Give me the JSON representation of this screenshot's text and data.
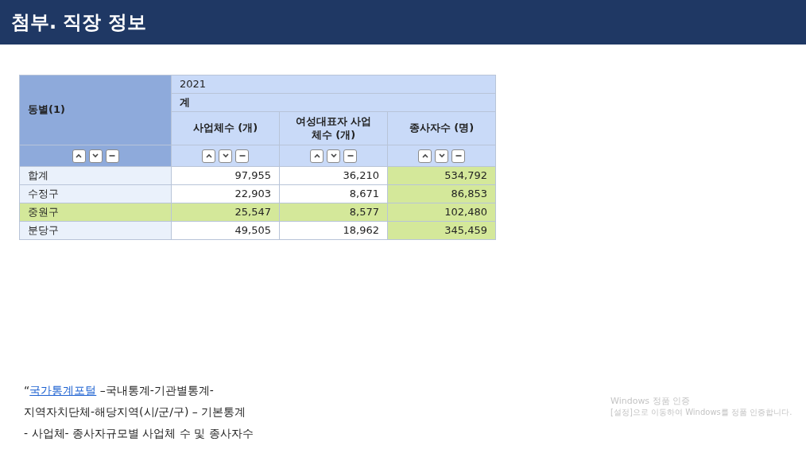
{
  "title": "첨부. 직장 정보",
  "table": {
    "row_header": "동별(1)",
    "year": "2021",
    "group": "계",
    "columns": [
      {
        "label": "사업체수 (개)",
        "highlighted": false
      },
      {
        "label": "여성대표자 사업\n체수 (개)",
        "highlighted": false
      },
      {
        "label": "종사자수 (명)",
        "highlighted": true
      }
    ],
    "rows": [
      {
        "name": "합계",
        "highlighted": false,
        "values": [
          "97,955",
          "36,210",
          "534,792"
        ]
      },
      {
        "name": "수정구",
        "highlighted": false,
        "values": [
          "22,903",
          "8,671",
          "86,853"
        ]
      },
      {
        "name": "중원구",
        "highlighted": true,
        "values": [
          "25,547",
          "8,577",
          "102,480"
        ]
      },
      {
        "name": "분당구",
        "highlighted": false,
        "values": [
          "49,505",
          "18,962",
          "345,459"
        ]
      }
    ]
  },
  "source": {
    "quote": "“",
    "link": "국가통계포털",
    "line_1_rest": " –국내통계-기관별통계-",
    "line_2": "지역자치단체-해당지역(시/군/구) – 기본통계",
    "line_3": "- 사업체- 종사자규모별 사업체 수 및 종사자수"
  },
  "activation": {
    "title": "Windows 정품 인증",
    "message": "[설정]으로 이동하여 Windows를 정품 인증합니다."
  }
}
